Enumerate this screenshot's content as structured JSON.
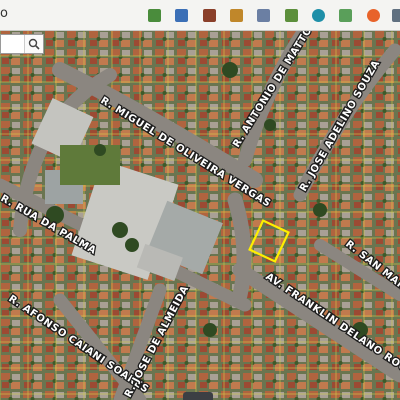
{
  "toolbar": {
    "lead_text": "o",
    "tools": [
      {
        "icon": "layer-add-icon",
        "color": "#4a8c3c"
      },
      {
        "icon": "zoom-search-icon",
        "color": "#3b6fb6"
      },
      {
        "icon": "cube-3d-icon",
        "color": "#8a3f2a"
      },
      {
        "icon": "edit-paint-icon",
        "color": "#c0872a"
      },
      {
        "icon": "measure-ruler-icon",
        "color": "#6b7fa3"
      },
      {
        "icon": "save-document-icon",
        "color": "#5c8f3c"
      },
      {
        "icon": "globe-icon",
        "color": "#1e8fa8"
      },
      {
        "icon": "map-layers-icon",
        "color": "#5a9f5a"
      },
      {
        "icon": "red-ball-icon",
        "color": "#e8632a"
      },
      {
        "icon": "satellite-icon",
        "color": "#607080"
      }
    ]
  },
  "search": {
    "value": "",
    "placeholder": ""
  },
  "streets": [
    {
      "name": "R. MIGUEL DE OLIVEIRA VERGAS"
    },
    {
      "name": "R. ANTONIO DE MATTOS PIRES"
    },
    {
      "name": "R. JOSE ADELINO SOUZA"
    },
    {
      "name": "R. SAN MARTIN"
    },
    {
      "name": "AV. FRANKLIN DELANO ROOSEVELT"
    },
    {
      "name": "R. RUA DA PALMA"
    },
    {
      "name": "R. AFONSO CAIANI SOARES"
    },
    {
      "name": "R. JOSE DE ALMEIDA"
    }
  ],
  "colors": {
    "street_label": "#ffffff",
    "street_label_outline": "#1c1c1c",
    "parcel_line": "#e7e04a",
    "selected_parcel": "#ffee00"
  }
}
